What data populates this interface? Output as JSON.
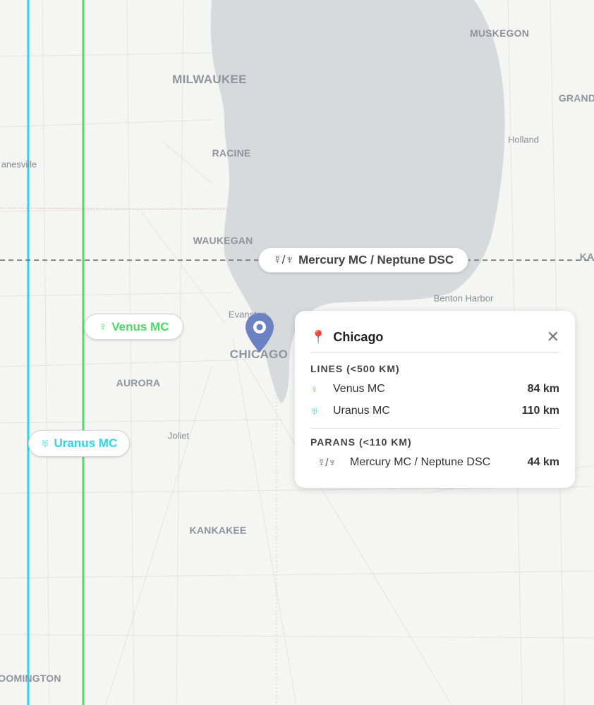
{
  "colors": {
    "venus": "#4cd964",
    "uranus": "#2ed3e6",
    "neptune": "#666666",
    "water": "#d7dadd",
    "land": "#f5f5f4",
    "pin": "#6b82c2"
  },
  "cities": [
    {
      "name": "MUSKEGON",
      "size": "mid"
    },
    {
      "name": "MILWAUKEE",
      "size": "major"
    },
    {
      "name": "GRAND",
      "size": "mid"
    },
    {
      "name": "Holland",
      "size": "minor"
    },
    {
      "name": "anesville",
      "size": "minor"
    },
    {
      "name": "RACINE",
      "size": "mid"
    },
    {
      "name": "WAUKEGAN",
      "size": "mid"
    },
    {
      "name": "KA",
      "size": "mid"
    },
    {
      "name": "Benton Harbor",
      "size": "minor"
    },
    {
      "name": "Evanston",
      "size": "minor"
    },
    {
      "name": "CHICAGO",
      "size": "major"
    },
    {
      "name": "AURORA",
      "size": "mid"
    },
    {
      "name": "Joliet",
      "size": "minor"
    },
    {
      "name": "KANKAKEE",
      "size": "mid"
    },
    {
      "name": "OOMINGTON",
      "size": "mid"
    }
  ],
  "map_labels": {
    "paran": {
      "glyph": "☿/♆",
      "text": "Mercury MC / Neptune DSC"
    },
    "venus": {
      "glyph": "♀",
      "text": "Venus MC"
    },
    "uranus": {
      "glyph": "♅",
      "text": "Uranus MC"
    }
  },
  "popup": {
    "title": "Chicago",
    "close_icon": "✕",
    "lines_header": "LINES (<500 KM)",
    "lines": [
      {
        "glyph": "♀",
        "name": "Venus MC",
        "distance": "84 km",
        "color": "#4cd964"
      },
      {
        "glyph": "♅",
        "name": "Uranus MC",
        "distance": "110 km",
        "color": "#2ed3e6"
      }
    ],
    "parans_header": "PARANS (<110 KM)",
    "parans": [
      {
        "glyph": "☿/♆",
        "name": "Mercury MC / Neptune DSC",
        "distance": "44 km"
      }
    ]
  }
}
